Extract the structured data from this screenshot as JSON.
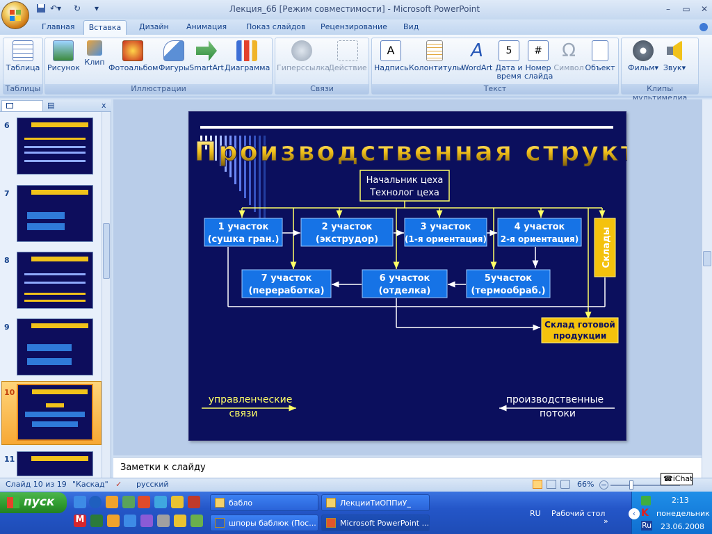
{
  "window": {
    "title": "Лекция_6б [Режим совместимости] - Microsoft PowerPoint"
  },
  "tabs": [
    "Главная",
    "Вставка",
    "Дизайн",
    "Анимация",
    "Показ слайдов",
    "Рецензирование",
    "Вид"
  ],
  "ribbon": {
    "groups": {
      "tables": "Таблицы",
      "illustrations": "Иллюстрации",
      "links": "Связи",
      "text": "Текст",
      "media": "Клипы мультимедиа"
    },
    "buttons": {
      "table": "Таблица",
      "picture": "Рисунок",
      "clip": "Клип",
      "album": "Фотоальбом",
      "shapes": "Фигуры",
      "smartart": "SmartArt",
      "chart": "Диаграмма",
      "hyperlink": "Гиперссылка",
      "action": "Действие",
      "textbox": "Надпись",
      "headerfooter": "Колонтитулы",
      "wordart": "WordArt",
      "datetime1": "Дата и",
      "datetime2": "время",
      "slidenum1": "Номер",
      "slidenum2": "слайда",
      "symbol": "Символ",
      "object": "Объект",
      "movie": "Фильм",
      "sound": "Звук"
    }
  },
  "slides_pane": {
    "numbers": [
      "6",
      "7",
      "8",
      "9",
      "10",
      "11"
    ],
    "selected": "10"
  },
  "slide": {
    "title": "Производственная структура",
    "head": {
      "line1": "Начальник цеха",
      "line2": "Технолог цеха"
    },
    "units": [
      {
        "l1": "1 участок",
        "l2": "(сушка гран.)"
      },
      {
        "l1": "2 участок",
        "l2": "(экструдор)"
      },
      {
        "l1": "3 участок",
        "l2": "(1-я ориентация)"
      },
      {
        "l1": "4 участок",
        "l2": "2-я ориентация)"
      },
      {
        "l1": "7 участок",
        "l2": "(переработка)"
      },
      {
        "l1": "6 участок",
        "l2": "(отделка)"
      },
      {
        "l1": "5участок",
        "l2": "(термообраб.)"
      }
    ],
    "warehouses": "Склады",
    "finished": {
      "l1": "Склад готовой",
      "l2": "продукции"
    },
    "legend": {
      "mgmt1": "управленческие",
      "mgmt2": "связи",
      "prod1": "производственные",
      "prod2": "потоки"
    }
  },
  "notes": {
    "placeholder": "Заметки к слайду"
  },
  "status": {
    "slide": "Слайд 10 из 19",
    "theme": "\"Каскад\"",
    "lang": "русский",
    "zoom": "66%"
  },
  "taskbar": {
    "start": "пуск",
    "tasks": [
      "бабло",
      "ЛекцииТиОППиУ_",
      "шпоры баблюк (Пос...",
      "Microsoft PowerPoint ..."
    ],
    "lang": "RU",
    "desktop": "Рабочий стол",
    "ichat": "iChat",
    "time": "2:13",
    "day": "понедельник",
    "date": "23.06.2008"
  },
  "colors": {
    "slide_bg": "#0b0f5d",
    "box_blue": "#1673e6",
    "box_yellow": "#f4c20d",
    "line": "#ffff66"
  }
}
